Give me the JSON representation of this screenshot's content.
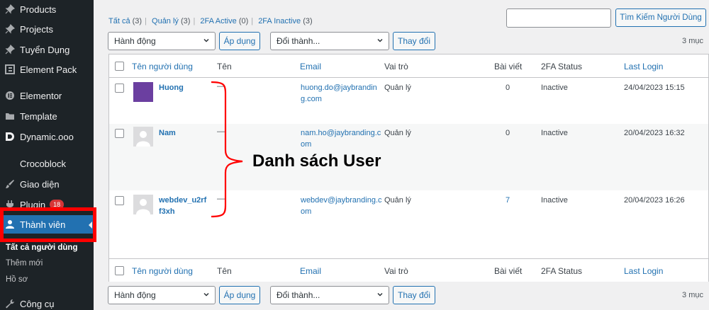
{
  "sidebar": {
    "items": [
      {
        "label": "Products",
        "icon": "pin-icon"
      },
      {
        "label": "Projects",
        "icon": "pin-icon"
      },
      {
        "label": "Tuyển Dụng",
        "icon": "pin-icon"
      },
      {
        "label": "Element Pack",
        "icon": "element-pack-icon"
      },
      {
        "label": "Elementor",
        "icon": "elementor-icon"
      },
      {
        "label": "Template",
        "icon": "folder-icon"
      },
      {
        "label": "Dynamic.ooo",
        "icon": "dynamic-icon"
      },
      {
        "label": "Crocoblock",
        "icon": ""
      },
      {
        "label": "Giao diện",
        "icon": "brush-icon"
      },
      {
        "label": "Plugin",
        "icon": "plugin-icon",
        "badge": "18"
      },
      {
        "label": "Thành viên",
        "icon": "user-icon"
      },
      {
        "label": "Công cụ",
        "icon": "wrench-icon"
      }
    ],
    "submenu": [
      "Tất cả người dùng",
      "Thêm mới",
      "Hồ sơ"
    ]
  },
  "views": {
    "all": "Tất cả",
    "all_count": "(3)",
    "admin": "Quản lý",
    "admin_count": "(3)",
    "active": "2FA Active",
    "active_count": "(0)",
    "inactive": "2FA Inactive",
    "inactive_count": "(3)"
  },
  "search": {
    "button": "Tìm Kiếm Người Dùng",
    "value": ""
  },
  "bulk": {
    "action_select": "Hành động",
    "apply": "Áp dụng",
    "role_select": "Đổi thành...",
    "change": "Thay đổi",
    "count": "3 mục"
  },
  "table": {
    "headers": {
      "username": "Tên người dùng",
      "name": "Tên",
      "email": "Email",
      "role": "Vai trò",
      "posts": "Bài viết",
      "twofa": "2FA Status",
      "last_login": "Last Login"
    },
    "rows": [
      {
        "username": "Huong",
        "name": "—",
        "email": "huong.do@jaybranding.com",
        "role": "Quản lý",
        "posts": "0",
        "twofa": "Inactive",
        "last_login": "24/04/2023 15:15",
        "avatar_color": "#6b3fa0"
      },
      {
        "username": "Nam",
        "name": "—",
        "email": "nam.ho@jaybranding.com",
        "role": "Quản lý",
        "posts": "0",
        "twofa": "Inactive",
        "last_login": "20/04/2023 16:32",
        "avatar_color": "#dcdcde"
      },
      {
        "username": "webdev_u2rff3xh",
        "name": "—",
        "email": "webdev@jaybranding.com",
        "role": "Quản lý",
        "posts": "7",
        "twofa": "Inactive",
        "last_login": "20/04/2023 16:26",
        "avatar_color": "#dcdcde"
      }
    ]
  },
  "annotation": {
    "label": "Danh sách User"
  },
  "colors": {
    "accent": "#2271b1",
    "sidebar": "#1d2327",
    "highlight": "#ff0000",
    "badge": "#d63638"
  }
}
